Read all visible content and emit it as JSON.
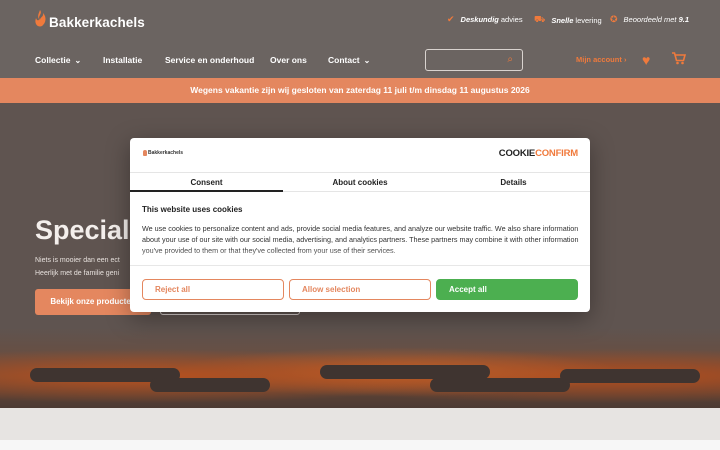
{
  "header": {
    "brand": "Bakkerkachels",
    "usps": [
      {
        "icon": "checkmark-icon",
        "bold": "Deskundig",
        "rest": "advies"
      },
      {
        "icon": "truck-icon",
        "bold": "Snelle",
        "rest": "levering"
      },
      {
        "icon": "star-badge-icon",
        "bold": "",
        "rest": "Beoordeeld met",
        "score": "9.1"
      }
    ]
  },
  "nav": {
    "items": [
      "Collectie",
      "Installatie",
      "Service en onderhoud",
      "Over ons",
      "Contact"
    ],
    "account": "Mijn account",
    "search_placeholder": ""
  },
  "announcement": "Wegens vakantie zijn wij gesloten van zaterdag 11 juli t/m dinsdag 11 augustus 2026",
  "hero": {
    "title": "Special",
    "line1": "Niets is mooier dan een ect",
    "line2": "Heerlijk met de familie geni",
    "primary_button": "Bekijk onze producten"
  },
  "cookie_modal": {
    "logo_text": "Bakkerkachels",
    "brand_part1": "COOKIE",
    "brand_part2": "CONFIRM",
    "tabs": [
      "Consent",
      "About cookies",
      "Details"
    ],
    "active_tab": "Consent",
    "heading": "This website uses cookies",
    "body": "We use cookies to personalize content and ads, provide social media features, and analyze our website traffic. We also share information about your use of our site with our social media, advertising, and analytics partners. These partners may combine it with other information you've provided to them or that they've collected from your use of their services.",
    "buttons": {
      "reject": "Reject all",
      "allow": "Allow selection",
      "accept": "Accept all"
    }
  },
  "colors": {
    "accent": "#f07a3c",
    "header_bg": "#6b6461",
    "announce_bg": "#e4875f",
    "accept_green": "#4caf50"
  }
}
